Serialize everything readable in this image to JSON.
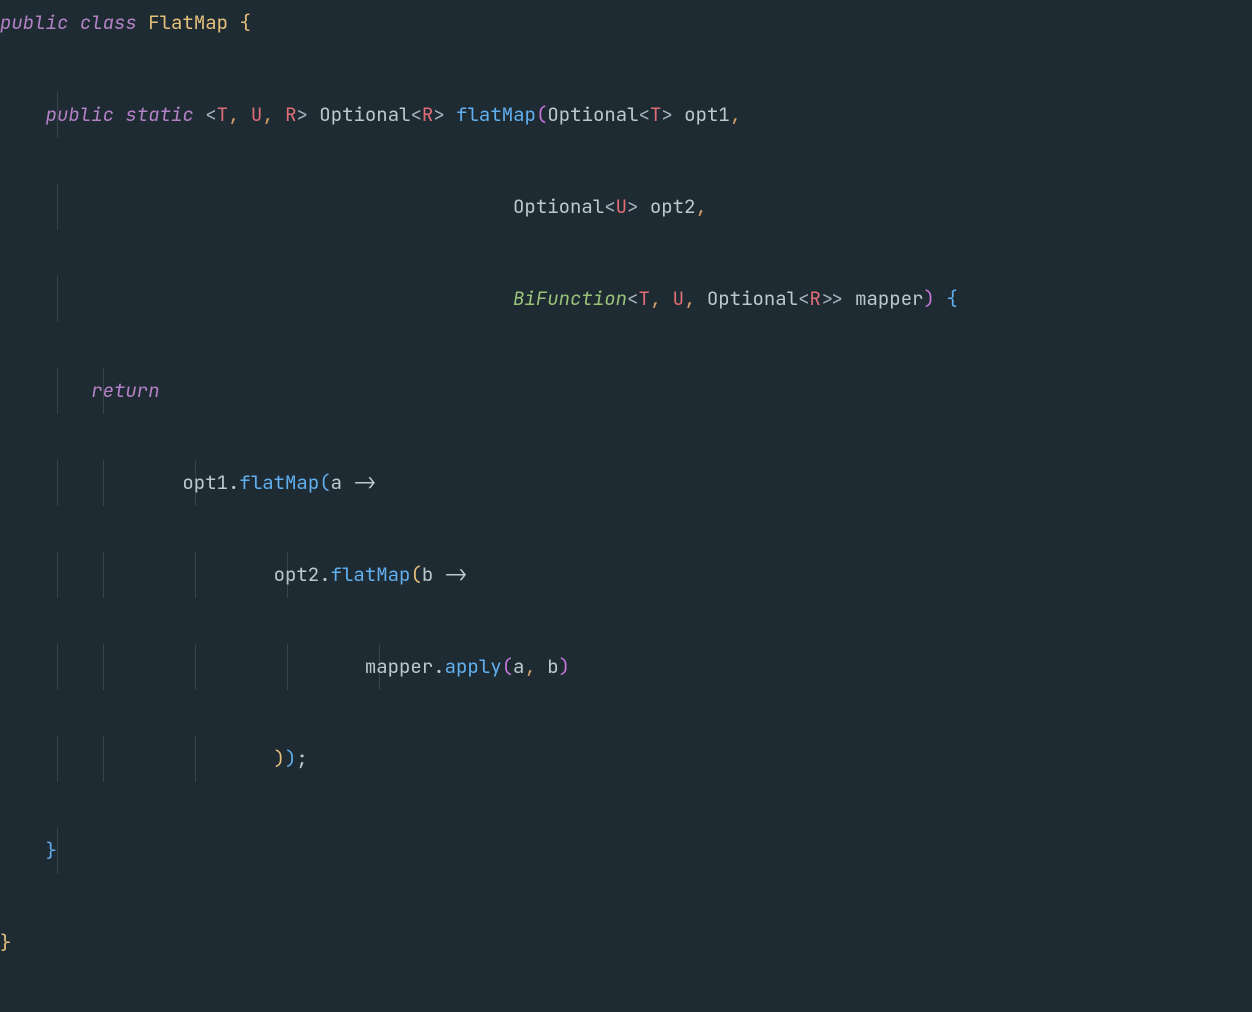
{
  "code": {
    "lang": "Java",
    "theme": "dark",
    "lines": {
      "l1": {
        "kw_public": "public",
        "kw_class": "class",
        "class_name": "FlatMap",
        "brace_open": "{"
      },
      "l2": {
        "kw_public": "public",
        "kw_static": "static",
        "gen_open": "<",
        "T": "T",
        "c1": ",",
        "U": "U",
        "c2": ",",
        "R": "R",
        "gen_close": ">",
        "ret_type": "Optional",
        "ret_gen_open": "<",
        "ret_R": "R",
        "ret_gen_close": ">",
        "method": "flatMap",
        "popen": "(",
        "p1_type": "Optional",
        "p1_go": "<",
        "p1_T": "T",
        "p1_gc": ">",
        "p1_name": "opt1",
        "comma": ","
      },
      "l3": {
        "type": "Optional",
        "go": "<",
        "g": "U",
        "gc": ">",
        "name": "opt2",
        "comma": ","
      },
      "l4": {
        "type": "BiFunction",
        "go": "<",
        "T": "T",
        "c1": ",",
        "U": "U",
        "c2": ",",
        "opt": "Optional",
        "go2": "<",
        "R": "R",
        "gc2": ">",
        "gc": ">",
        "name": "mapper",
        "pclose": ")",
        "brace": "{"
      },
      "l5": {
        "return": "return"
      },
      "l6": {
        "obj": "opt1",
        "dot": ".",
        "method": "flatMap",
        "popen": "(",
        "arg": "a",
        "arrow": "->"
      },
      "l7": {
        "obj": "opt2",
        "dot": ".",
        "method": "flatMap",
        "popen": "(",
        "arg": "b",
        "arrow": "->"
      },
      "l8": {
        "obj": "mapper",
        "dot": ".",
        "method": "apply",
        "popen": "(",
        "a": "a",
        "comma": ",",
        "b": "b",
        "pclose": ")"
      },
      "l9": {
        "pclose1": ")",
        "pclose2": ")",
        "semi": ";"
      },
      "l10": {
        "brace": "}"
      },
      "l11": {
        "brace": "}"
      }
    }
  }
}
